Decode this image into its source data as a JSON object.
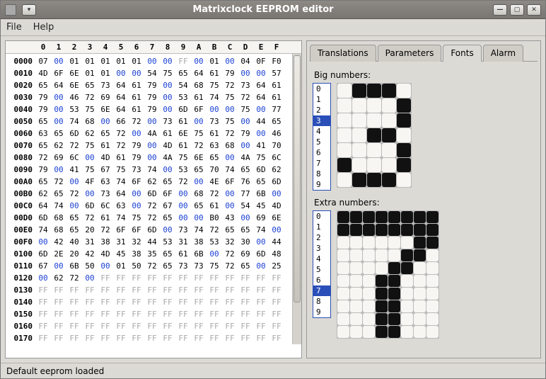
{
  "window_title": "Matrixclock EEPROM editor",
  "menu": {
    "file": "File",
    "help": "Help"
  },
  "statusbar": "Default eeprom loaded",
  "tabs": {
    "translations": "Translations",
    "parameters": "Parameters",
    "fonts": "Fonts",
    "alarm": "Alarm"
  },
  "fonts": {
    "big_label": "Big numbers:",
    "extra_label": "Extra numbers:",
    "numbers": [
      "0",
      "1",
      "2",
      "3",
      "4",
      "5",
      "6",
      "7",
      "8",
      "9"
    ],
    "big_selected": 3,
    "extra_selected": 7,
    "big_grid": {
      "cols": 5,
      "rows": 7,
      "cellsize": 20,
      "on": [
        [
          0,
          1
        ],
        [
          0,
          2
        ],
        [
          0,
          3
        ],
        [
          1,
          4
        ],
        [
          2,
          4
        ],
        [
          3,
          2
        ],
        [
          3,
          3
        ],
        [
          4,
          4
        ],
        [
          5,
          0
        ],
        [
          5,
          4
        ],
        [
          6,
          1
        ],
        [
          6,
          2
        ],
        [
          6,
          3
        ]
      ]
    },
    "extra_grid": {
      "cols": 8,
      "rows": 10,
      "cellsize": 17,
      "on": [
        [
          0,
          0
        ],
        [
          0,
          1
        ],
        [
          0,
          2
        ],
        [
          0,
          3
        ],
        [
          0,
          4
        ],
        [
          0,
          5
        ],
        [
          0,
          6
        ],
        [
          0,
          7
        ],
        [
          1,
          0
        ],
        [
          1,
          1
        ],
        [
          1,
          2
        ],
        [
          1,
          3
        ],
        [
          1,
          4
        ],
        [
          1,
          5
        ],
        [
          1,
          6
        ],
        [
          1,
          7
        ],
        [
          2,
          6
        ],
        [
          2,
          7
        ],
        [
          3,
          5
        ],
        [
          3,
          6
        ],
        [
          4,
          4
        ],
        [
          4,
          5
        ],
        [
          5,
          3
        ],
        [
          5,
          4
        ],
        [
          6,
          3
        ],
        [
          6,
          4
        ],
        [
          7,
          3
        ],
        [
          7,
          4
        ],
        [
          8,
          3
        ],
        [
          8,
          4
        ],
        [
          9,
          3
        ],
        [
          9,
          4
        ]
      ]
    }
  },
  "hex": {
    "col_headers": [
      "0",
      "1",
      "2",
      "3",
      "4",
      "5",
      "6",
      "7",
      "8",
      "9",
      "A",
      "B",
      "C",
      "D",
      "E",
      "F"
    ],
    "rows": [
      {
        "addr": "0000",
        "cells": [
          "07",
          "00",
          "01",
          "01",
          "01",
          "01",
          "01",
          "00",
          "00",
          "FF",
          "00",
          "01",
          "00",
          "04",
          "0F",
          "F0"
        ]
      },
      {
        "addr": "0010",
        "cells": [
          "4D",
          "6F",
          "6E",
          "01",
          "01",
          "00",
          "00",
          "54",
          "75",
          "65",
          "64",
          "61",
          "79",
          "00",
          "00",
          "57"
        ]
      },
      {
        "addr": "0020",
        "cells": [
          "65",
          "64",
          "6E",
          "65",
          "73",
          "64",
          "61",
          "79",
          "00",
          "54",
          "68",
          "75",
          "72",
          "73",
          "64",
          "61"
        ]
      },
      {
        "addr": "0030",
        "cells": [
          "79",
          "00",
          "46",
          "72",
          "69",
          "64",
          "61",
          "79",
          "00",
          "53",
          "61",
          "74",
          "75",
          "72",
          "64",
          "61"
        ]
      },
      {
        "addr": "0040",
        "cells": [
          "79",
          "00",
          "53",
          "75",
          "6E",
          "64",
          "61",
          "79",
          "00",
          "6D",
          "6F",
          "00",
          "00",
          "75",
          "00",
          "77"
        ]
      },
      {
        "addr": "0050",
        "cells": [
          "65",
          "00",
          "74",
          "68",
          "00",
          "66",
          "72",
          "00",
          "73",
          "61",
          "00",
          "73",
          "75",
          "00",
          "44",
          "65"
        ]
      },
      {
        "addr": "0060",
        "cells": [
          "63",
          "65",
          "6D",
          "62",
          "65",
          "72",
          "00",
          "4A",
          "61",
          "6E",
          "75",
          "61",
          "72",
          "79",
          "00",
          "46"
        ]
      },
      {
        "addr": "0070",
        "cells": [
          "65",
          "62",
          "72",
          "75",
          "61",
          "72",
          "79",
          "00",
          "4D",
          "61",
          "72",
          "63",
          "68",
          "00",
          "41",
          "70"
        ]
      },
      {
        "addr": "0080",
        "cells": [
          "72",
          "69",
          "6C",
          "00",
          "4D",
          "61",
          "79",
          "00",
          "4A",
          "75",
          "6E",
          "65",
          "00",
          "4A",
          "75",
          "6C"
        ]
      },
      {
        "addr": "0090",
        "cells": [
          "79",
          "00",
          "41",
          "75",
          "67",
          "75",
          "73",
          "74",
          "00",
          "53",
          "65",
          "70",
          "74",
          "65",
          "6D",
          "62"
        ]
      },
      {
        "addr": "00A0",
        "cells": [
          "65",
          "72",
          "00",
          "4F",
          "63",
          "74",
          "6F",
          "62",
          "65",
          "72",
          "00",
          "4E",
          "6F",
          "76",
          "65",
          "6D"
        ]
      },
      {
        "addr": "00B0",
        "cells": [
          "62",
          "65",
          "72",
          "00",
          "73",
          "64",
          "00",
          "6D",
          "6F",
          "00",
          "68",
          "72",
          "00",
          "77",
          "6B",
          "00"
        ]
      },
      {
        "addr": "00C0",
        "cells": [
          "64",
          "74",
          "00",
          "6D",
          "6C",
          "63",
          "00",
          "72",
          "67",
          "00",
          "65",
          "61",
          "00",
          "54",
          "45",
          "4D"
        ]
      },
      {
        "addr": "00D0",
        "cells": [
          "6D",
          "68",
          "65",
          "72",
          "61",
          "74",
          "75",
          "72",
          "65",
          "00",
          "00",
          "B0",
          "43",
          "00",
          "69",
          "6E"
        ]
      },
      {
        "addr": "00E0",
        "cells": [
          "74",
          "68",
          "65",
          "20",
          "72",
          "6F",
          "6F",
          "6D",
          "00",
          "73",
          "74",
          "72",
          "65",
          "65",
          "74",
          "00"
        ]
      },
      {
        "addr": "00F0",
        "cells": [
          "00",
          "42",
          "40",
          "31",
          "38",
          "31",
          "32",
          "44",
          "53",
          "31",
          "38",
          "53",
          "32",
          "30",
          "00",
          "44"
        ]
      },
      {
        "addr": "0100",
        "cells": [
          "6D",
          "2E",
          "20",
          "42",
          "4D",
          "45",
          "38",
          "35",
          "65",
          "61",
          "6B",
          "00",
          "72",
          "69",
          "6D",
          "48"
        ]
      },
      {
        "addr": "0110",
        "cells": [
          "67",
          "00",
          "6B",
          "50",
          "00",
          "01",
          "50",
          "72",
          "65",
          "73",
          "73",
          "75",
          "72",
          "65",
          "00",
          "25"
        ]
      },
      {
        "addr": "0120",
        "cells": [
          "00",
          "62",
          "72",
          "00",
          "FF",
          "FF",
          "FF",
          "FF",
          "FF",
          "FF",
          "FF",
          "FF",
          "FF",
          "FF",
          "FF",
          "FF"
        ]
      },
      {
        "addr": "0130",
        "cells": [
          "FF",
          "FF",
          "FF",
          "FF",
          "FF",
          "FF",
          "FF",
          "FF",
          "FF",
          "FF",
          "FF",
          "FF",
          "FF",
          "FF",
          "FF",
          "FF"
        ]
      },
      {
        "addr": "0140",
        "cells": [
          "FF",
          "FF",
          "FF",
          "FF",
          "FF",
          "FF",
          "FF",
          "FF",
          "FF",
          "FF",
          "FF",
          "FF",
          "FF",
          "FF",
          "FF",
          "FF"
        ]
      },
      {
        "addr": "0150",
        "cells": [
          "FF",
          "FF",
          "FF",
          "FF",
          "FF",
          "FF",
          "FF",
          "FF",
          "FF",
          "FF",
          "FF",
          "FF",
          "FF",
          "FF",
          "FF",
          "FF"
        ]
      },
      {
        "addr": "0160",
        "cells": [
          "FF",
          "FF",
          "FF",
          "FF",
          "FF",
          "FF",
          "FF",
          "FF",
          "FF",
          "FF",
          "FF",
          "FF",
          "FF",
          "FF",
          "FF",
          "FF"
        ]
      },
      {
        "addr": "0170",
        "cells": [
          "FF",
          "FF",
          "FF",
          "FF",
          "FF",
          "FF",
          "FF",
          "FF",
          "FF",
          "FF",
          "FF",
          "FF",
          "FF",
          "FF",
          "FF",
          "FF"
        ]
      }
    ]
  }
}
